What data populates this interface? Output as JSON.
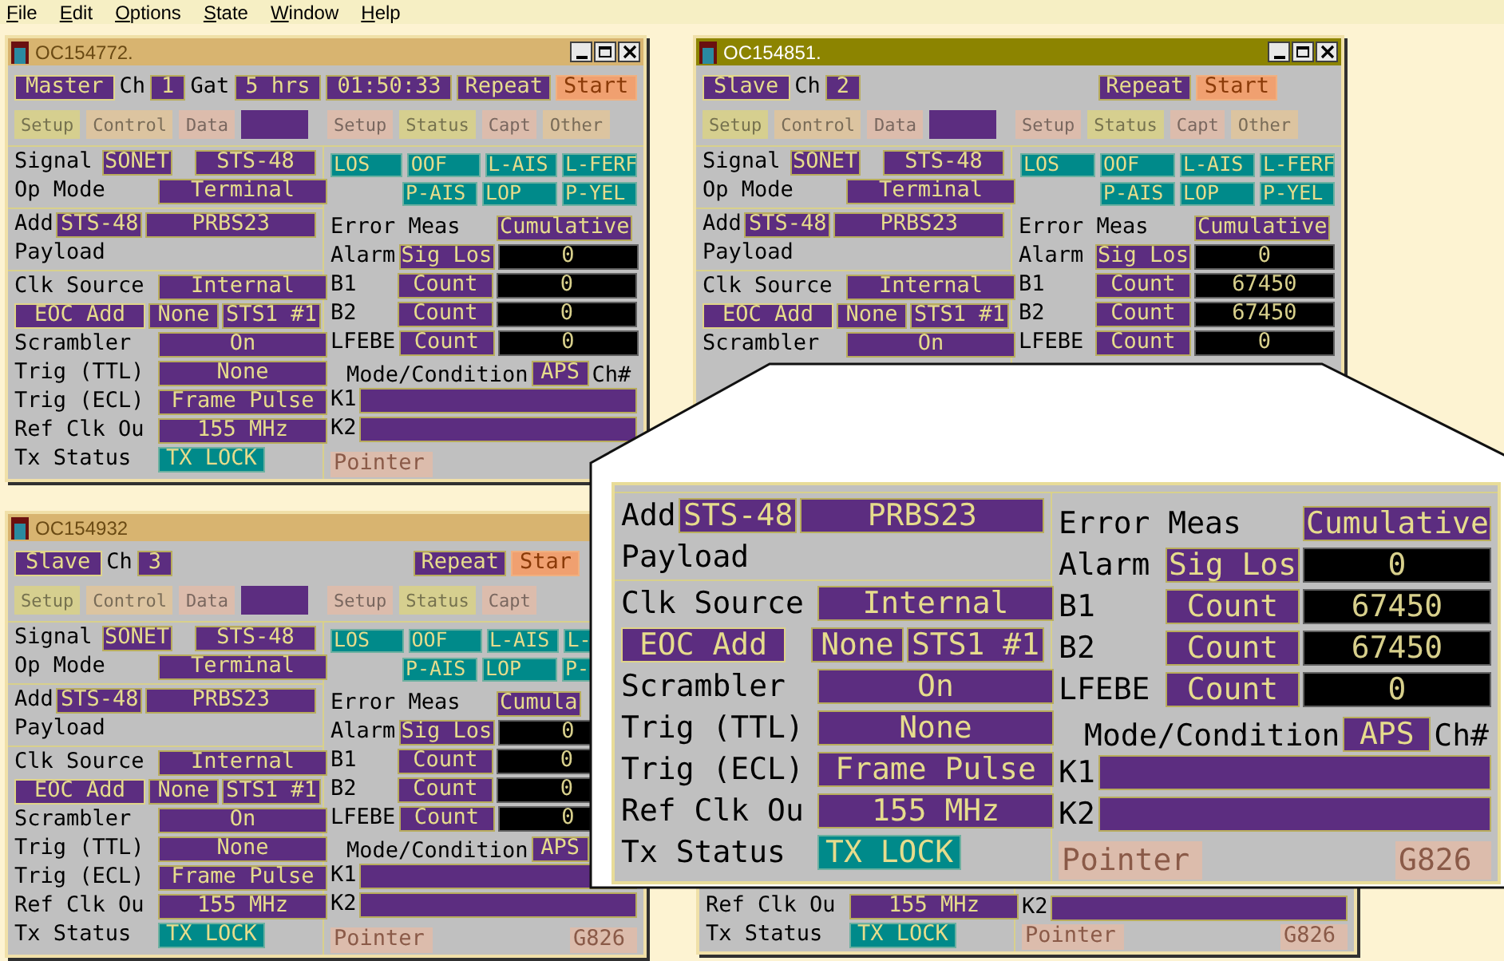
{
  "menu": [
    "File",
    "Edit",
    "Options",
    "State",
    "Window",
    "Help"
  ],
  "windows": [
    {
      "title": "OC154772.",
      "active": false,
      "window_buttons": true,
      "header": [
        {
          "kind": "button",
          "text": "Master"
        },
        {
          "kind": "label",
          "text": "Ch"
        },
        {
          "kind": "value",
          "text": "1"
        },
        {
          "kind": "label",
          "text": "Gat"
        },
        {
          "kind": "value",
          "text": "5 hrs"
        },
        {
          "kind": "value",
          "text": "01:50:33"
        },
        {
          "kind": "toggle",
          "text": "Repeat"
        },
        {
          "kind": "start",
          "text": "Start"
        }
      ],
      "tabs": [
        {
          "label": "Setup",
          "color": "#d6cf8f"
        },
        {
          "label": "Control",
          "color": "#dcc4a0"
        },
        {
          "label": "Data",
          "color": "#dcbcac"
        },
        {
          "color": "#5c2d80"
        },
        {
          "label": "Setup",
          "color": "#dcbcac"
        },
        {
          "label": "Status",
          "color": "#d6cf8f"
        },
        {
          "label": "Capt",
          "color": "#dcbcac"
        },
        {
          "label": "Other",
          "color": "#dcc4a0"
        }
      ],
      "left_sections": [
        [
          {
            "kind": "signal",
            "label": "Signal",
            "controls": [
              {
                "kind": "value",
                "text": "SONET"
              },
              {
                "kind": "value",
                "text": "STS-48"
              }
            ]
          },
          {
            "kind": "field",
            "label": "Op Mode",
            "controls": [
              {
                "kind": "value",
                "text": "Terminal"
              }
            ]
          }
        ],
        [
          {
            "kind": "add",
            "label": "Add",
            "controls": [
              {
                "kind": "value",
                "text": "STS-48"
              },
              {
                "kind": "value",
                "text": "PRBS23"
              }
            ]
          },
          {
            "kind": "text",
            "label": "Payload"
          }
        ],
        [
          {
            "kind": "field",
            "label": "Clk Source",
            "controls": [
              {
                "kind": "value",
                "text": "Internal"
              }
            ]
          },
          {
            "kind": "eoc",
            "controls": [
              {
                "kind": "button",
                "text": "EOC Add"
              },
              {
                "kind": "value",
                "text": "None"
              },
              {
                "kind": "value",
                "text": "STS1 #1"
              }
            ]
          },
          {
            "kind": "field",
            "label": "Scrambler",
            "controls": [
              {
                "kind": "value",
                "text": "On"
              }
            ]
          },
          {
            "kind": "field",
            "label": "Trig (TTL)",
            "controls": [
              {
                "kind": "value",
                "text": "None"
              }
            ]
          },
          {
            "kind": "field",
            "label": "Trig (ECL)",
            "controls": [
              {
                "kind": "value",
                "text": "Frame Pulse"
              }
            ]
          },
          {
            "kind": "field",
            "label": "Ref Clk Ou",
            "controls": [
              {
                "kind": "value",
                "text": "155 MHz"
              }
            ]
          },
          {
            "kind": "field",
            "label": "Tx Status",
            "controls": [
              {
                "kind": "status",
                "text": "TX LOCK"
              }
            ]
          }
        ]
      ],
      "right_rows": [
        {
          "kind": "alarms",
          "items": [
            "LOS",
            "OOF",
            "L-AIS",
            "L-FERF"
          ]
        },
        {
          "kind": "alarms",
          "items": [
            "P-AIS",
            "LOP",
            "P-YEL"
          ]
        },
        {
          "kind": "meas",
          "label": "Error Meas",
          "controls": [
            {
              "kind": "value",
              "text": "Cumulative"
            }
          ]
        },
        {
          "kind": "counter",
          "label": "Alarm",
          "controls": [
            {
              "kind": "value",
              "text": "Sig Los"
            },
            {
              "kind": "counter",
              "text": "0"
            }
          ]
        },
        {
          "kind": "counter",
          "label": "B1",
          "controls": [
            {
              "kind": "value",
              "text": "Count"
            },
            {
              "kind": "counter",
              "text": "0"
            }
          ]
        },
        {
          "kind": "counter",
          "label": "B2",
          "controls": [
            {
              "kind": "value",
              "text": "Count"
            },
            {
              "kind": "counter",
              "text": "0"
            }
          ]
        },
        {
          "kind": "counter",
          "label": "LFEBE",
          "controls": [
            {
              "kind": "value",
              "text": "Count"
            },
            {
              "kind": "counter",
              "text": "0"
            }
          ]
        },
        {
          "kind": "mode",
          "label": "Mode/Condition",
          "controls": [
            {
              "kind": "value",
              "text": "APS"
            },
            {
              "kind": "label",
              "text": "Ch#"
            }
          ]
        },
        {
          "kind": "register",
          "label": "K1",
          "controls": [
            {
              "kind": "bar"
            }
          ]
        },
        {
          "kind": "register",
          "label": "K2",
          "controls": [
            {
              "kind": "bar"
            }
          ]
        }
      ],
      "buttons": [
        {
          "text": "Pointer"
        }
      ]
    },
    {
      "title": "OC154851.",
      "active": true,
      "window_buttons": true,
      "header": [
        {
          "kind": "button",
          "text": "Slave"
        },
        {
          "kind": "label",
          "text": "Ch"
        },
        {
          "kind": "value",
          "text": "2"
        },
        {
          "kind": "toggle",
          "text": "Repeat"
        },
        {
          "kind": "start",
          "text": "Start"
        }
      ],
      "tabs": [
        {
          "label": "Setup",
          "color": "#d6cf8f"
        },
        {
          "label": "Control",
          "color": "#dcc4a0"
        },
        {
          "label": "Data",
          "color": "#dcbcac"
        },
        {
          "color": "#5c2d80"
        },
        {
          "label": "Setup",
          "color": "#dcbcac"
        },
        {
          "label": "Status",
          "color": "#d6cf8f"
        },
        {
          "label": "Capt",
          "color": "#dcbcac"
        },
        {
          "label": "Other",
          "color": "#dcc4a0"
        }
      ],
      "left_sections": [
        [
          {
            "kind": "signal",
            "label": "Signal",
            "controls": [
              {
                "kind": "value",
                "text": "SONET"
              },
              {
                "kind": "value",
                "text": "STS-48"
              }
            ]
          },
          {
            "kind": "field",
            "label": "Op Mode",
            "controls": [
              {
                "kind": "value",
                "text": "Terminal"
              }
            ]
          }
        ],
        [
          {
            "kind": "add",
            "label": "Add",
            "controls": [
              {
                "kind": "value",
                "text": "STS-48"
              },
              {
                "kind": "value",
                "text": "PRBS23"
              }
            ]
          },
          {
            "kind": "text",
            "label": "Payload"
          }
        ],
        [
          {
            "kind": "field",
            "label": "Clk Source",
            "controls": [
              {
                "kind": "value",
                "text": "Internal"
              }
            ]
          },
          {
            "kind": "eoc",
            "controls": [
              {
                "kind": "button",
                "text": "EOC Add"
              },
              {
                "kind": "value",
                "text": "None"
              },
              {
                "kind": "value",
                "text": "STS1 #1"
              }
            ]
          },
          {
            "kind": "field",
            "label": "Scrambler",
            "controls": [
              {
                "kind": "value",
                "text": "On"
              }
            ]
          }
        ]
      ],
      "right_rows": [
        {
          "kind": "alarms",
          "items": [
            "LOS",
            "OOF",
            "L-AIS",
            "L-FERF"
          ]
        },
        {
          "kind": "alarms",
          "items": [
            "P-AIS",
            "LOP",
            "P-YEL"
          ]
        },
        {
          "kind": "meas",
          "label": "Error Meas",
          "controls": [
            {
              "kind": "value",
              "text": "Cumulative"
            }
          ]
        },
        {
          "kind": "counter",
          "label": "Alarm",
          "controls": [
            {
              "kind": "value",
              "text": "Sig Los"
            },
            {
              "kind": "counter",
              "text": "0"
            }
          ]
        },
        {
          "kind": "counter",
          "label": "B1",
          "controls": [
            {
              "kind": "value",
              "text": "Count"
            },
            {
              "kind": "counter",
              "text": "67450"
            }
          ]
        },
        {
          "kind": "counter",
          "label": "B2",
          "controls": [
            {
              "kind": "value",
              "text": "Count"
            },
            {
              "kind": "counter",
              "text": "67450"
            }
          ]
        },
        {
          "kind": "counter",
          "label": "LFEBE",
          "controls": [
            {
              "kind": "value",
              "text": "Count"
            },
            {
              "kind": "counter",
              "text": "0"
            }
          ]
        }
      ]
    },
    {
      "title": "OC154932",
      "active": false,
      "window_buttons": false,
      "header": [
        {
          "kind": "button",
          "text": "Slave"
        },
        {
          "kind": "label",
          "text": "Ch"
        },
        {
          "kind": "value",
          "text": "3"
        },
        {
          "kind": "toggle",
          "text": "Repeat"
        },
        {
          "kind": "start",
          "text": "Star"
        }
      ],
      "tabs": [
        {
          "label": "Setup",
          "color": "#d6cf8f"
        },
        {
          "label": "Control",
          "color": "#dcc4a0"
        },
        {
          "label": "Data",
          "color": "#dcbcac"
        },
        {
          "color": "#5c2d80"
        },
        {
          "label": "Setup",
          "color": "#dcbcac"
        },
        {
          "label": "Status",
          "color": "#d6cf8f"
        },
        {
          "label": "Capt",
          "color": "#dcbcac"
        }
      ],
      "left_sections": [
        [
          {
            "kind": "signal",
            "label": "Signal",
            "controls": [
              {
                "kind": "value",
                "text": "SONET"
              },
              {
                "kind": "value",
                "text": "STS-48"
              }
            ]
          },
          {
            "kind": "field",
            "label": "Op Mode",
            "controls": [
              {
                "kind": "value",
                "text": "Terminal"
              }
            ]
          }
        ],
        [
          {
            "kind": "add",
            "label": "Add",
            "controls": [
              {
                "kind": "value",
                "text": "STS-48"
              },
              {
                "kind": "value",
                "text": "PRBS23"
              }
            ]
          },
          {
            "kind": "text",
            "label": "Payload"
          }
        ],
        [
          {
            "kind": "field",
            "label": "Clk Source",
            "controls": [
              {
                "kind": "value",
                "text": "Internal"
              }
            ]
          },
          {
            "kind": "eoc",
            "controls": [
              {
                "kind": "button",
                "text": "EOC Add"
              },
              {
                "kind": "value",
                "text": "None"
              },
              {
                "kind": "value",
                "text": "STS1 #1"
              }
            ]
          },
          {
            "kind": "field",
            "label": "Scrambler",
            "controls": [
              {
                "kind": "value",
                "text": "On"
              }
            ]
          },
          {
            "kind": "field",
            "label": "Trig (TTL)",
            "controls": [
              {
                "kind": "value",
                "text": "None"
              }
            ]
          },
          {
            "kind": "field",
            "label": "Trig (ECL)",
            "controls": [
              {
                "kind": "value",
                "text": "Frame Pulse"
              }
            ]
          },
          {
            "kind": "field",
            "label": "Ref Clk Ou",
            "controls": [
              {
                "kind": "value",
                "text": "155 MHz"
              }
            ]
          },
          {
            "kind": "field",
            "label": "Tx Status",
            "controls": [
              {
                "kind": "status",
                "text": "TX LOCK"
              }
            ]
          }
        ]
      ],
      "right_rows": [
        {
          "kind": "alarms",
          "items": [
            "LOS",
            "OOF",
            "L-AIS",
            "L-"
          ]
        },
        {
          "kind": "alarms",
          "items": [
            "P-AIS",
            "LOP",
            "P-"
          ]
        },
        {
          "kind": "meas",
          "label": "Error Meas",
          "controls": [
            {
              "kind": "value",
              "text": "Cumula"
            }
          ]
        },
        {
          "kind": "counter",
          "label": "Alarm",
          "controls": [
            {
              "kind": "value",
              "text": "Sig Los"
            },
            {
              "kind": "counter",
              "text": "0"
            }
          ]
        },
        {
          "kind": "counter",
          "label": "B1",
          "controls": [
            {
              "kind": "value",
              "text": "Count"
            },
            {
              "kind": "counter",
              "text": "0"
            }
          ]
        },
        {
          "kind": "counter",
          "label": "B2",
          "controls": [
            {
              "kind": "value",
              "text": "Count"
            },
            {
              "kind": "counter",
              "text": "0"
            }
          ]
        },
        {
          "kind": "counter",
          "label": "LFEBE",
          "controls": [
            {
              "kind": "value",
              "text": "Count"
            },
            {
              "kind": "counter",
              "text": "0"
            }
          ]
        },
        {
          "kind": "mode",
          "label": "Mode/Condition",
          "controls": [
            {
              "kind": "value",
              "text": "APS"
            }
          ]
        },
        {
          "kind": "register",
          "label": "K1",
          "controls": [
            {
              "kind": "bar"
            }
          ]
        },
        {
          "kind": "register",
          "label": "K2",
          "controls": [
            {
              "kind": "bar"
            }
          ]
        }
      ],
      "buttons": [
        {
          "text": "Pointer"
        },
        {
          "text": "G826"
        }
      ]
    },
    {
      "left_sections": [
        [
          {
            "kind": "field",
            "label": "Ref Clk Ou",
            "controls": [
              {
                "kind": "value",
                "text": "155 MHz"
              }
            ]
          },
          {
            "kind": "field",
            "label": "Tx Status",
            "controls": [
              {
                "kind": "status",
                "text": "TX LOCK"
              }
            ]
          }
        ]
      ],
      "right_rows": [
        {
          "kind": "register",
          "label": "K2",
          "controls": [
            {
              "kind": "bar"
            }
          ]
        }
      ],
      "buttons": [
        {
          "text": "Pointer"
        },
        {
          "text": "G826"
        }
      ]
    }
  ],
  "magnifier": {
    "left_sections": [
      [
        {
          "kind": "add",
          "label": "Add",
          "controls": [
            {
              "kind": "value",
              "text": "STS-48"
            },
            {
              "kind": "value",
              "text": "PRBS23"
            }
          ]
        },
        {
          "kind": "text",
          "label": "Payload"
        }
      ],
      [
        {
          "kind": "field",
          "label": "Clk Source",
          "controls": [
            {
              "kind": "value",
              "text": "Internal"
            }
          ]
        },
        {
          "kind": "eoc",
          "controls": [
            {
              "kind": "button",
              "text": "EOC Add"
            },
            {
              "kind": "value",
              "text": "None"
            },
            {
              "kind": "value",
              "text": "STS1 #1"
            }
          ]
        },
        {
          "kind": "field",
          "label": "Scrambler",
          "controls": [
            {
              "kind": "value",
              "text": "On"
            }
          ]
        },
        {
          "kind": "field",
          "label": "Trig (TTL)",
          "controls": [
            {
              "kind": "value",
              "text": "None"
            }
          ]
        },
        {
          "kind": "field",
          "label": "Trig (ECL)",
          "controls": [
            {
              "kind": "value",
              "text": "Frame Pulse"
            }
          ]
        },
        {
          "kind": "field",
          "label": "Ref Clk Ou",
          "controls": [
            {
              "kind": "value",
              "text": "155 MHz"
            }
          ]
        },
        {
          "kind": "field",
          "label": "Tx Status",
          "controls": [
            {
              "kind": "status",
              "text": "TX LOCK"
            }
          ]
        }
      ]
    ],
    "right_rows": [
      {
        "kind": "meas",
        "label": "Error Meas",
        "controls": [
          {
            "kind": "value",
            "text": "Cumulative"
          }
        ]
      },
      {
        "kind": "counter",
        "label": "Alarm",
        "controls": [
          {
            "kind": "value",
            "text": "Sig Los"
          },
          {
            "kind": "counter",
            "text": "0"
          }
        ]
      },
      {
        "kind": "counter",
        "label": "B1",
        "controls": [
          {
            "kind": "value",
            "text": "Count"
          },
          {
            "kind": "counter",
            "text": "67450"
          }
        ]
      },
      {
        "kind": "counter",
        "label": "B2",
        "controls": [
          {
            "kind": "value",
            "text": "Count"
          },
          {
            "kind": "counter",
            "text": "67450"
          }
        ]
      },
      {
        "kind": "counter",
        "label": "LFEBE",
        "controls": [
          {
            "kind": "value",
            "text": "Count"
          },
          {
            "kind": "counter",
            "text": "0"
          }
        ]
      },
      {
        "kind": "mode",
        "label": "Mode/Condition",
        "controls": [
          {
            "kind": "value",
            "text": "APS"
          },
          {
            "kind": "label",
            "text": "Ch#"
          }
        ]
      },
      {
        "kind": "register",
        "label": "K1",
        "controls": [
          {
            "kind": "bar"
          }
        ]
      },
      {
        "kind": "register",
        "label": "K2",
        "controls": [
          {
            "kind": "bar"
          }
        ]
      }
    ],
    "buttons": [
      {
        "text": "Pointer"
      },
      {
        "text": "G826"
      }
    ]
  }
}
